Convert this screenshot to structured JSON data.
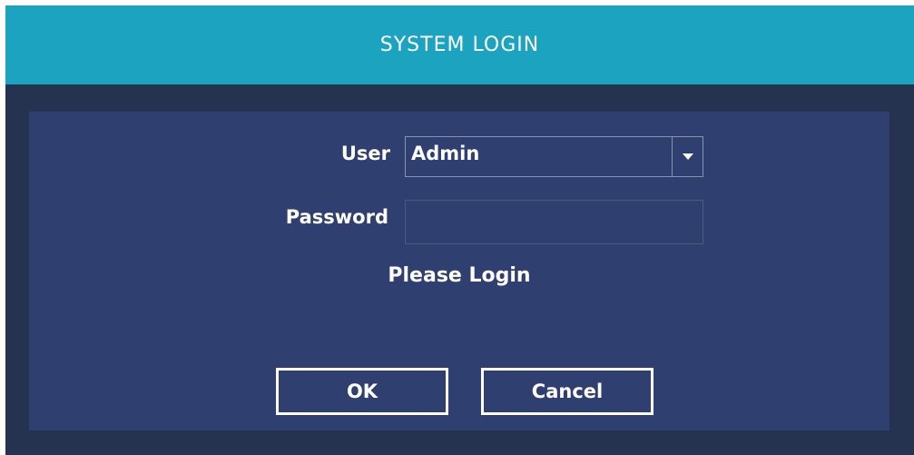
{
  "window": {
    "title": "SYSTEM LOGIN"
  },
  "form": {
    "user_label": "User",
    "user_value": "Admin",
    "password_label": "Password",
    "password_value": "",
    "status_text": "Please Login"
  },
  "buttons": {
    "ok_label": "OK",
    "cancel_label": "Cancel"
  },
  "icons": {
    "dropdown": "chevron-down-icon"
  },
  "colors": {
    "titlebar": "#1ba3c0",
    "dialog_bg": "#253350",
    "panel_bg": "#2f4070",
    "text": "#ffffff"
  }
}
